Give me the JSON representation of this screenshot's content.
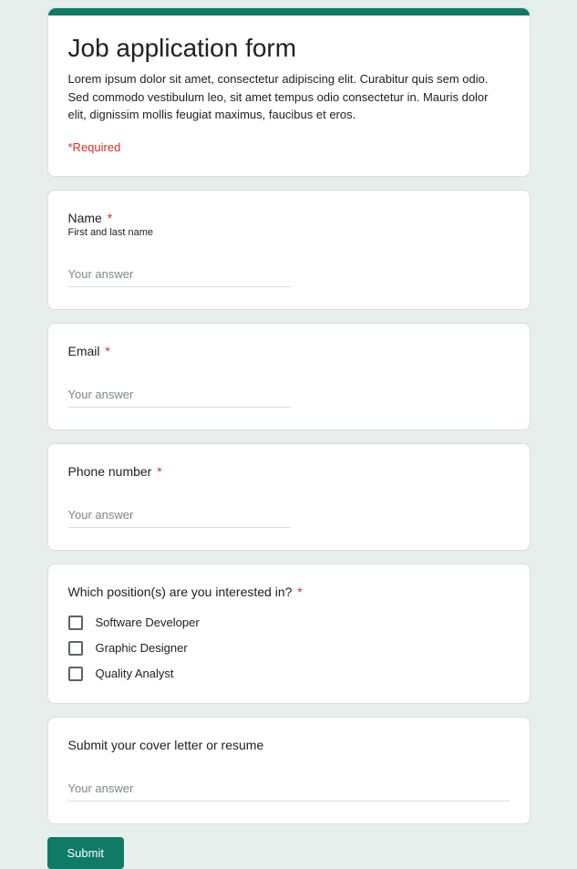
{
  "header": {
    "title": "Job application form",
    "description": "Lorem ipsum dolor sit amet, consectetur adipiscing elit. Curabitur quis sem odio. Sed commodo vestibulum leo, sit amet tempus odio consectetur in. Mauris dolor elit, dignissim mollis feugiat maximus, faucibus et eros.",
    "required_note": "*Required"
  },
  "questions": {
    "name": {
      "label": "Name",
      "help": "First and last name",
      "placeholder": "Your answer",
      "required_star": "*"
    },
    "email": {
      "label": "Email",
      "placeholder": "Your answer",
      "required_star": "*"
    },
    "phone": {
      "label": "Phone number",
      "placeholder": "Your answer",
      "required_star": "*"
    },
    "positions": {
      "label": "Which position(s) are you interested in?",
      "required_star": "*",
      "options": [
        "Software Developer",
        "Graphic Designer",
        "Quality Analyst"
      ]
    },
    "cover": {
      "label": "Submit your cover letter or resume",
      "placeholder": "Your answer"
    }
  },
  "submit_label": "Submit"
}
